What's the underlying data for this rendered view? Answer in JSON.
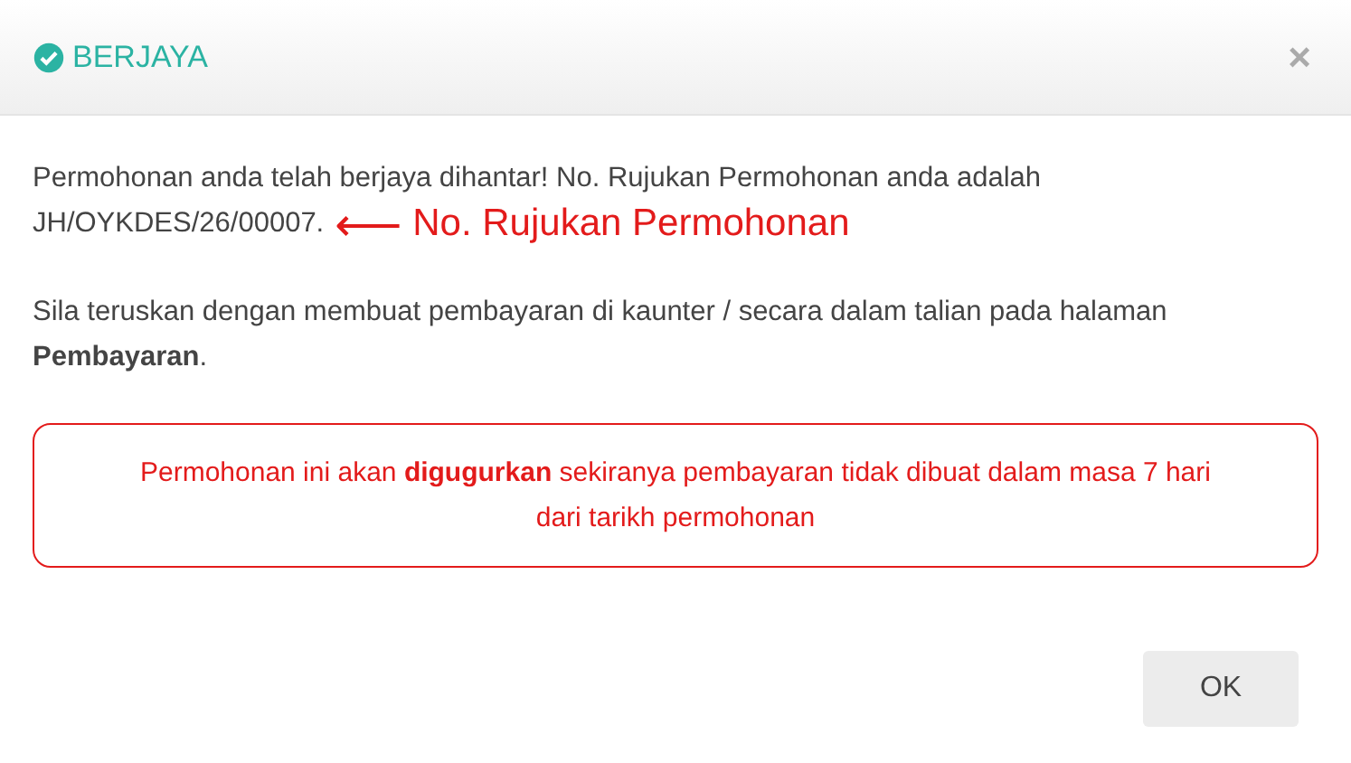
{
  "dialog": {
    "title": "BERJAYA",
    "close": "×"
  },
  "message": "Permohonan anda telah berjaya dihantar! No. Rujukan Permohonan anda adalah",
  "reference_number": "JH/OYKDES/26/00007.",
  "annotation": {
    "arrow": "⟵",
    "label": "No. Rujukan Permohonan"
  },
  "instruction": "Sila teruskan dengan membuat pembayaran di kaunter / secara dalam talian pada halaman **Pembayaran**.",
  "warning": "Permohonan ini akan **digugurkan** sekiranya pembayaran tidak dibuat dalam masa 7 hari dari tarikh permohonan",
  "buttons": [
    "OK"
  ]
}
